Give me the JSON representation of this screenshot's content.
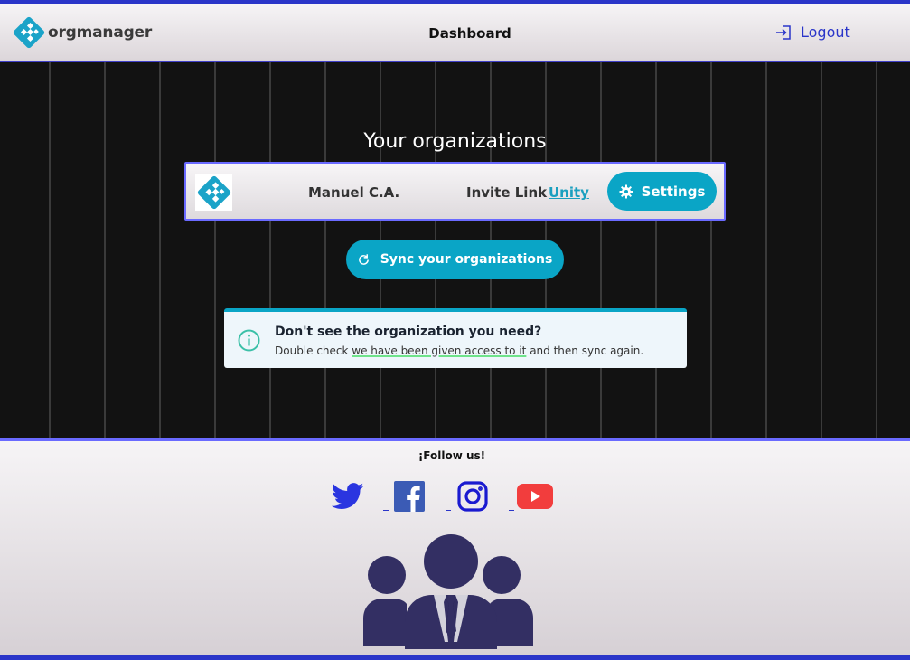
{
  "app": {
    "brand": "orgmanager"
  },
  "header": {
    "title": "Dashboard",
    "logout_label": "Logout"
  },
  "main": {
    "section_title": "Your organizations",
    "organizations": [
      {
        "name": "Manuel C.A.",
        "invite_label": "Invite Link",
        "invite_link_text": "Unity",
        "settings_label": "Settings"
      }
    ],
    "sync_label": "Sync your organizations",
    "notice": {
      "title": "Don't see the organization you need?",
      "text_before": "Double check ",
      "text_highlight": "we have been given access to it",
      "text_after": " and then sync again."
    }
  },
  "footer": {
    "follow_label": "¡Follow us!",
    "social": [
      "twitter-icon",
      "facebook-icon",
      "instagram-icon",
      "youtube-icon"
    ]
  },
  "colors": {
    "accent": "#0aa5c6",
    "header_border": "#2a35c9",
    "team_icon": "#332f63"
  }
}
